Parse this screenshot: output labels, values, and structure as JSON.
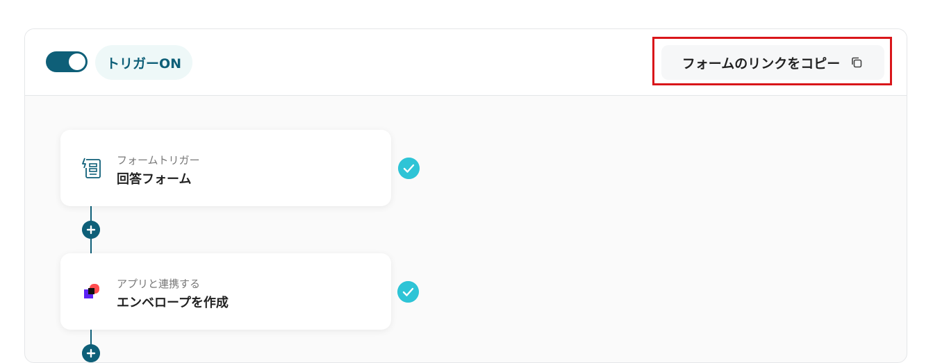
{
  "header": {
    "toggle_state": "on",
    "trigger_label": "トリガーON",
    "copy_button_label": "フォームのリンクをコピー"
  },
  "steps": [
    {
      "subtitle": "フォームトリガー",
      "title": "回答フォーム",
      "status": "complete"
    },
    {
      "subtitle": "アプリと連携する",
      "title": "エンベロープを作成",
      "status": "complete"
    }
  ],
  "colors": {
    "accent": "#0e5f78",
    "check": "#2ec4d6",
    "highlight": "#d9161a"
  }
}
